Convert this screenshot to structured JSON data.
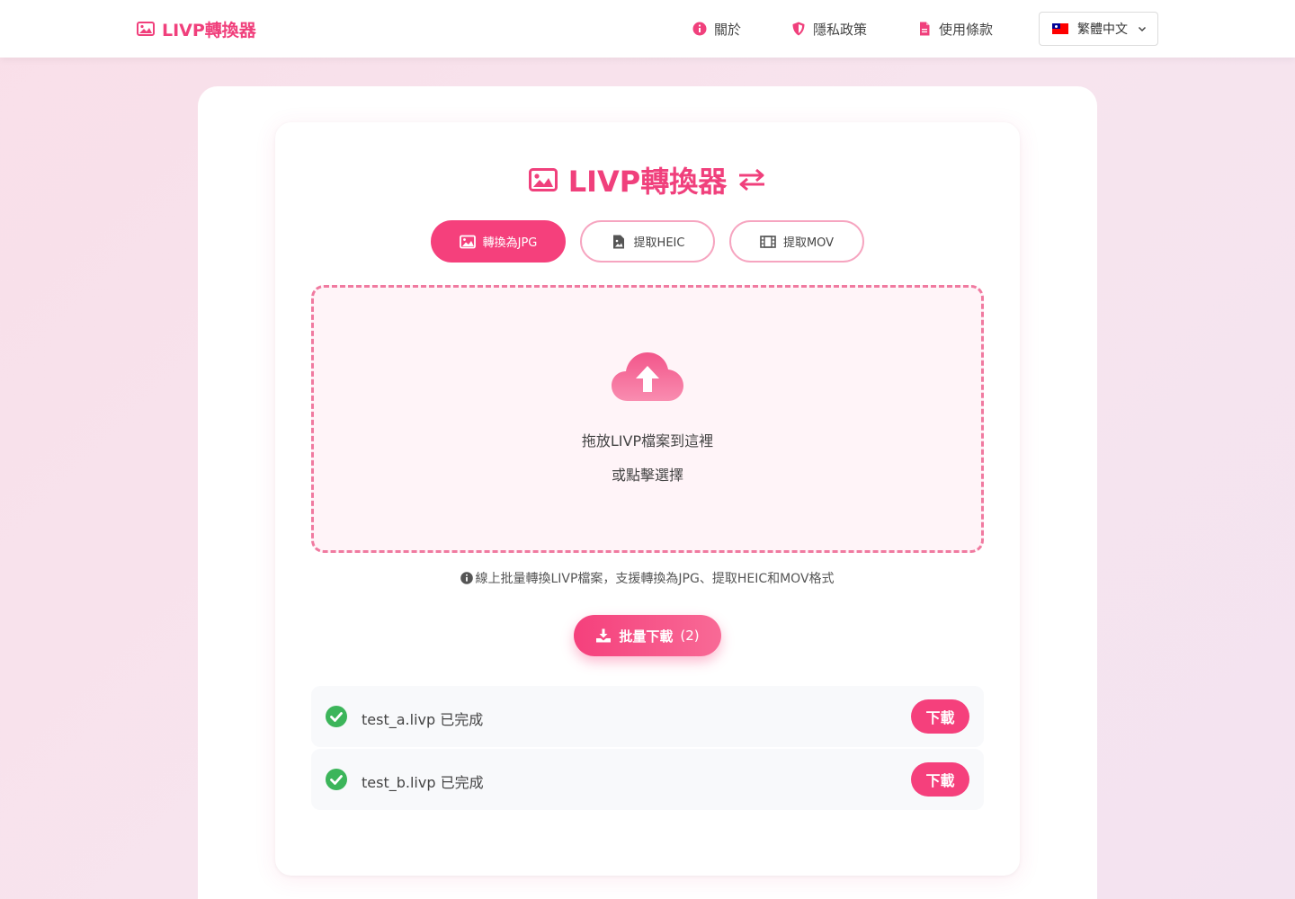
{
  "navbar": {
    "brand": "LIVP轉換器",
    "links": [
      {
        "label": "關於",
        "icon": "info-circle-icon"
      },
      {
        "label": "隱私政策",
        "icon": "shield-icon"
      },
      {
        "label": "使用條款",
        "icon": "document-icon"
      }
    ],
    "language": {
      "selected": "繁體中文",
      "icon": "taiwan-flag-icon"
    }
  },
  "main": {
    "title": "LIVP轉換器",
    "modes": [
      {
        "label": "轉換為JPG",
        "icon": "image-icon",
        "active": true
      },
      {
        "label": "提取HEIC",
        "icon": "file-image-icon",
        "active": false
      },
      {
        "label": "提取MOV",
        "icon": "film-icon",
        "active": false
      }
    ],
    "dropzone": {
      "line1": "拖放LIVP檔案到這裡",
      "line2": "或點擊選擇"
    },
    "info_text": "線上批量轉換LIVP檔案，支援轉換為JPG、提取HEIC和MOV格式",
    "batch_download": {
      "label": "批量下載",
      "count": "(2)"
    },
    "files": [
      {
        "name": "test_a.livp 已完成",
        "status": "done",
        "download_label": "下載"
      },
      {
        "name": "test_b.livp 已完成",
        "status": "done",
        "download_label": "下載"
      }
    ]
  },
  "colors": {
    "accent": "#f5407c",
    "accent_light": "#f6a5c0",
    "success": "#3cb55a",
    "dropzone_bg": "#fff4f8"
  }
}
